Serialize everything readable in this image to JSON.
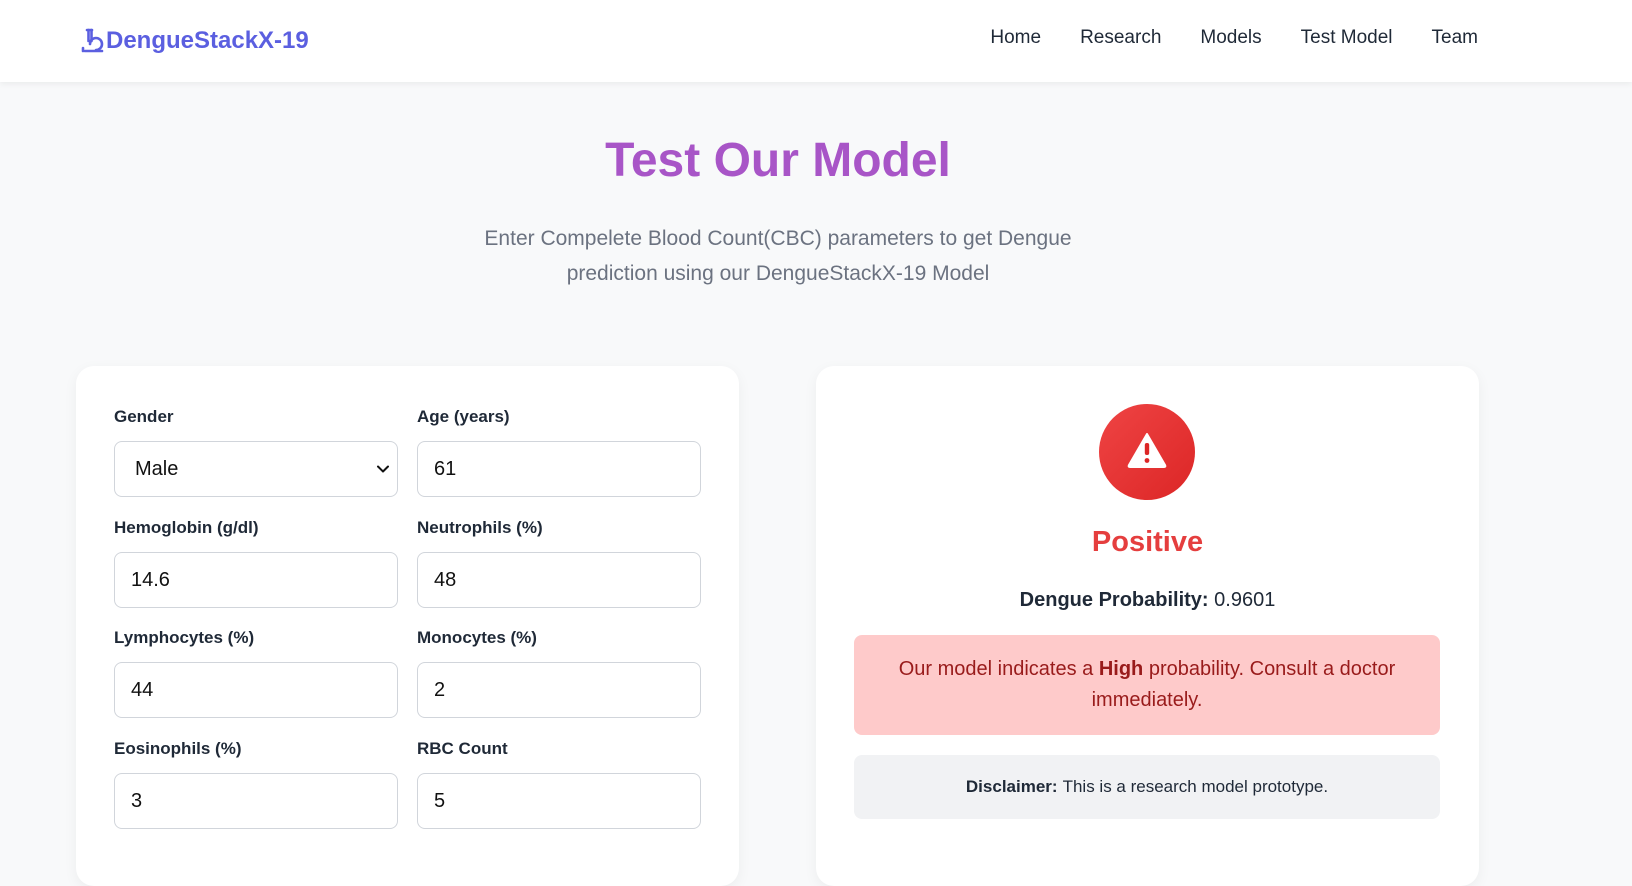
{
  "brand": {
    "name": "DengueStackX-19",
    "icon": "microscope-icon",
    "color": "#5b5fe0"
  },
  "nav": {
    "items": [
      {
        "label": "Home"
      },
      {
        "label": "Research"
      },
      {
        "label": "Models"
      },
      {
        "label": "Test Model"
      },
      {
        "label": "Team"
      }
    ]
  },
  "hero": {
    "title": "Test Our Model",
    "subtitle_line1": "Enter Compelete Blood Count(CBC) parameters to get Dengue",
    "subtitle_line2": "prediction using our DengueStackX-19 Model",
    "title_color": "#a855c7"
  },
  "form": {
    "gender": {
      "label": "Gender",
      "value": "Male",
      "options": [
        "Male"
      ]
    },
    "age": {
      "label": "Age (years)",
      "value": "61"
    },
    "hemoglobin": {
      "label": "Hemoglobin (g/dl)",
      "value": "14.6"
    },
    "neutrophils": {
      "label": "Neutrophils (%)",
      "value": "48"
    },
    "lymphocytes": {
      "label": "Lymphocytes (%)",
      "value": "44"
    },
    "monocytes": {
      "label": "Monocytes (%)",
      "value": "2"
    },
    "eosinophils": {
      "label": "Eosinophils (%)",
      "value": "3"
    },
    "rbc": {
      "label": "RBC Count",
      "value": "5"
    }
  },
  "result": {
    "icon": "warning-icon",
    "label": "Positive",
    "status_color": "#e53e3e",
    "probability_label": "Dengue Probability:",
    "probability_value": "0.9601",
    "alert_prefix": "Our model indicates a",
    "alert_level": "High",
    "alert_suffix": "probability. Consult a doctor immediately.",
    "disclaimer_label": "Disclaimer:",
    "disclaimer_text": "This is a research model prototype."
  }
}
